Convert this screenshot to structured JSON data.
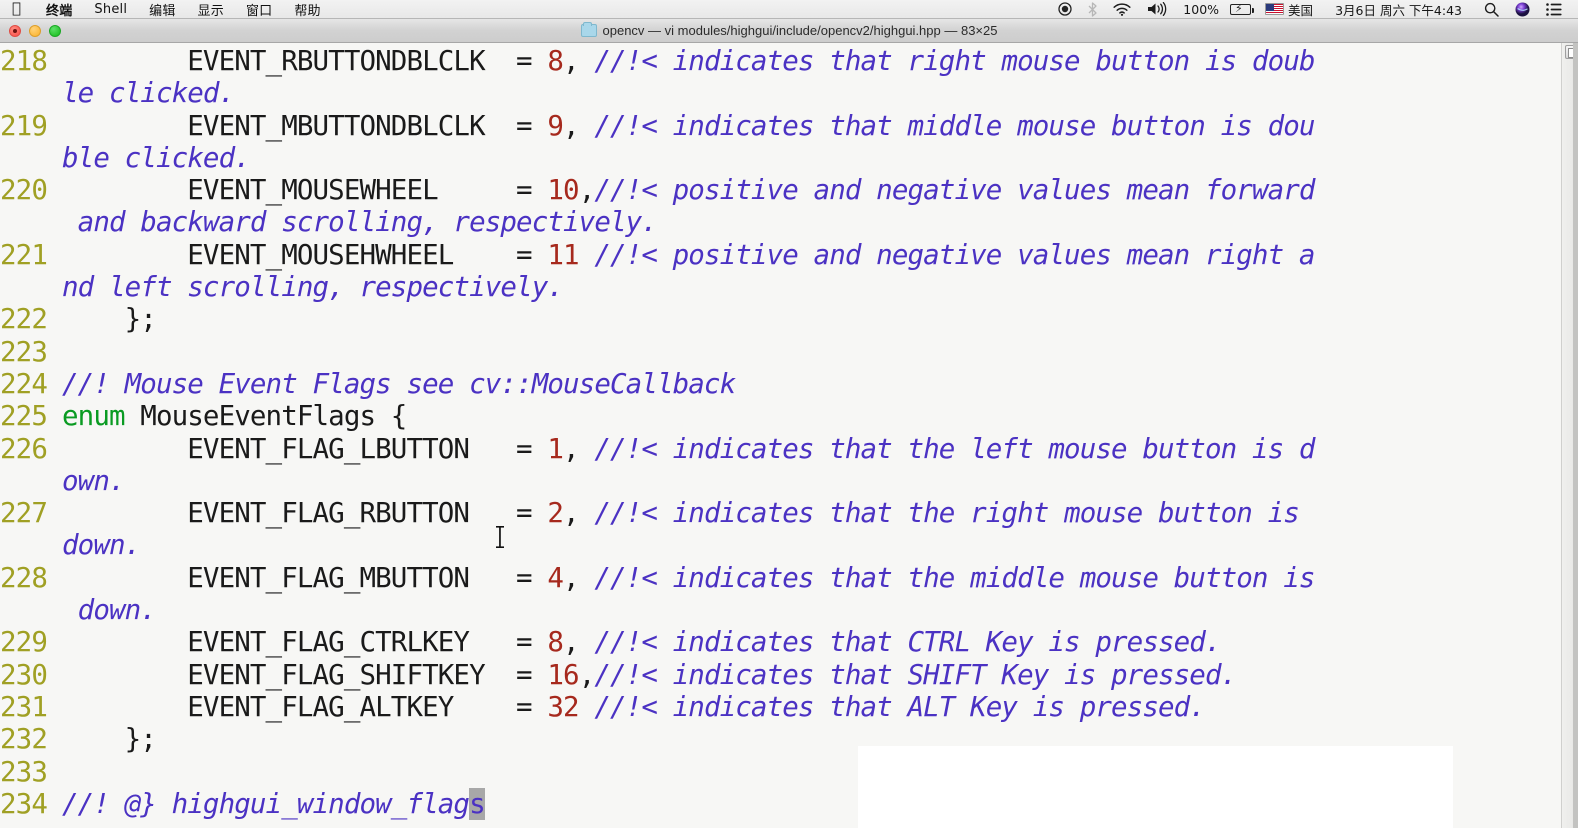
{
  "menubar": {
    "apple_icon": "apple-logo-icon",
    "items": [
      {
        "label": "终端",
        "bold": true
      },
      {
        "label": "Shell",
        "bold": false
      },
      {
        "label": "编辑",
        "bold": false
      },
      {
        "label": "显示",
        "bold": false
      },
      {
        "label": "窗口",
        "bold": false
      },
      {
        "label": "帮助",
        "bold": false
      }
    ],
    "status": {
      "screen_recording_icon": "record-indicator-icon",
      "bluetooth_icon": "bluetooth-icon",
      "wifi_icon": "wifi-icon",
      "volume_icon": "volume-icon",
      "battery_percent": "100%",
      "battery_icon": "battery-charging-icon",
      "input_flag_icon": "us-flag-icon",
      "input_label": "美国",
      "datetime": "3月6日 周六 下午4:43",
      "search_icon": "spotlight-search-icon",
      "siri_icon": "siri-icon",
      "control_center_icon": "control-center-icon"
    }
  },
  "window": {
    "traffic_lights": {
      "close": "close-button",
      "minimize": "minimize-button",
      "zoom": "zoom-button"
    },
    "folder_icon": "folder-icon",
    "title": "opencv — vi modules/highgui/include/opencv2/highgui.hpp — 83×25"
  },
  "editor": {
    "colors": {
      "background": "#f7f7f5",
      "line_number": "#a0a024",
      "keyword": "#0a9b22",
      "identifier": "#1a1a1a",
      "number": "#a6291d",
      "comment": "#4b32c3",
      "cursor_block": "#a8a8a8"
    },
    "cursor": {
      "line": 234,
      "char": "s",
      "word": "highgui_window_flags"
    },
    "lines": [
      {
        "n": "218",
        "code": "        EVENT_RBUTTONDBLCLK  = ",
        "value": "8",
        "sep": ", ",
        "comment": "//!< indicates that right mouse button is doub",
        "wrap": "le clicked."
      },
      {
        "n": "219",
        "code": "        EVENT_MBUTTONDBLCLK  = ",
        "value": "9",
        "sep": ", ",
        "comment": "//!< indicates that middle mouse button is dou",
        "wrap": "ble clicked."
      },
      {
        "n": "220",
        "code": "        EVENT_MOUSEWHEEL     = ",
        "value": "10",
        "sep": ",",
        "comment": "//!< positive and negative values mean forward",
        "wrap": " and backward scrolling, respectively."
      },
      {
        "n": "221",
        "code": "        EVENT_MOUSEHWHEEL    = ",
        "value": "11",
        "sep": " ",
        "comment": "//!< positive and negative values mean right a",
        "wrap": "nd left scrolling, respectively."
      },
      {
        "n": "222",
        "code": "    };",
        "value": "",
        "sep": "",
        "comment": "",
        "wrap": ""
      },
      {
        "n": "223",
        "code": "",
        "value": "",
        "sep": "",
        "comment": "",
        "wrap": ""
      },
      {
        "n": "224",
        "code": "",
        "value": "",
        "sep": "",
        "comment": "//! Mouse Event Flags see cv::MouseCallback",
        "wrap": ""
      },
      {
        "n": "225",
        "keyword": "enum",
        "code": " MouseEventFlags {",
        "value": "",
        "sep": "",
        "comment": "",
        "wrap": ""
      },
      {
        "n": "226",
        "code": "        EVENT_FLAG_LBUTTON   = ",
        "value": "1",
        "sep": ", ",
        "comment": "//!< indicates that the left mouse button is d",
        "wrap": "own."
      },
      {
        "n": "227",
        "code": "        EVENT_FLAG_RBUTTON   = ",
        "value": "2",
        "sep": ", ",
        "comment": "//!< indicates that the right mouse button is",
        "wrap": "down."
      },
      {
        "n": "228",
        "code": "        EVENT_FLAG_MBUTTON   = ",
        "value": "4",
        "sep": ", ",
        "comment": "//!< indicates that the middle mouse button is",
        "wrap": " down."
      },
      {
        "n": "229",
        "code": "        EVENT_FLAG_CTRLKEY   = ",
        "value": "8",
        "sep": ", ",
        "comment": "//!< indicates that CTRL Key is pressed.",
        "wrap": ""
      },
      {
        "n": "230",
        "code": "        EVENT_FLAG_SHIFTKEY  = ",
        "value": "16",
        "sep": ",",
        "comment": "//!< indicates that SHIFT Key is pressed.",
        "wrap": ""
      },
      {
        "n": "231",
        "code": "        EVENT_FLAG_ALTKEY    = ",
        "value": "32",
        "sep": " ",
        "comment": "//!< indicates that ALT Key is pressed.",
        "wrap": ""
      },
      {
        "n": "232",
        "code": "    };",
        "value": "",
        "sep": "",
        "comment": "",
        "wrap": ""
      },
      {
        "n": "233",
        "code": "",
        "value": "",
        "sep": "",
        "comment": "",
        "wrap": ""
      },
      {
        "n": "234",
        "code": "",
        "value": "",
        "sep": "",
        "comment": "//! @} highgui_window_flag",
        "cursor_char": "s",
        "wrap": ""
      }
    ]
  },
  "scrollbar": {
    "thumb_label": "scrollbar-thumb"
  }
}
